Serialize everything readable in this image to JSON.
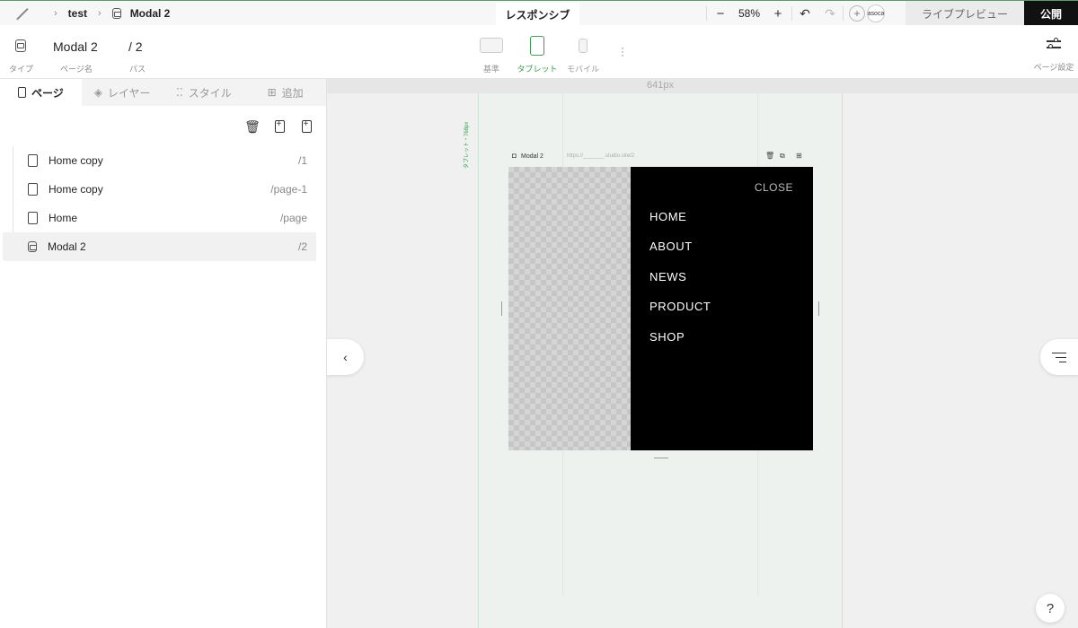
{
  "breadcrumb": {
    "project": "test",
    "page": "Modal 2"
  },
  "responsive_tab": "レスポンシブ",
  "zoom": {
    "value": "58%",
    "minus": "−",
    "plus": "+"
  },
  "history": {
    "undo": "↶",
    "redo": "↷"
  },
  "user": {
    "avatar": "asoca"
  },
  "buttons": {
    "preview": "ライブプレビュー",
    "publish": "公開"
  },
  "page_meta": {
    "type_label": "タイプ",
    "name_label": "ページ名",
    "name_value": "Modal 2",
    "path_label": "パス",
    "path_value": "/ 2"
  },
  "devices": {
    "base": "基準",
    "tablet": "タブレット",
    "mobile": "モバイル",
    "active": "tablet"
  },
  "settings_label": "ページ設定",
  "tabs": [
    {
      "label": "ページ",
      "icon": "pages-icon",
      "active": true
    },
    {
      "label": "レイヤー",
      "icon": "layers-icon",
      "active": false
    },
    {
      "label": "スタイル",
      "icon": "style-icon",
      "active": false
    },
    {
      "label": "追加",
      "icon": "add-icon",
      "active": false
    }
  ],
  "pages": [
    {
      "name": "Home copy",
      "path": "/1",
      "type": "page"
    },
    {
      "name": "Home copy",
      "path": "/page-1",
      "type": "page"
    },
    {
      "name": "Home",
      "path": "/page",
      "type": "page"
    },
    {
      "name": "Modal 2",
      "path": "/2",
      "type": "modal",
      "selected": true
    }
  ],
  "canvas": {
    "ruler_label": "641px",
    "breakpoint_label": "タブレット・768px",
    "frame_name": "Modal 2",
    "frame_url": "https://_______.studio.site/2",
    "modal": {
      "close": "CLOSE",
      "items": [
        "HOME",
        "ABOUT",
        "NEWS",
        "PRODUCT",
        "SHOP"
      ]
    }
  },
  "help": "?",
  "colors": {
    "accent": "#3c9a54",
    "publish_bg": "#111111",
    "menu_bg": "#000000"
  }
}
